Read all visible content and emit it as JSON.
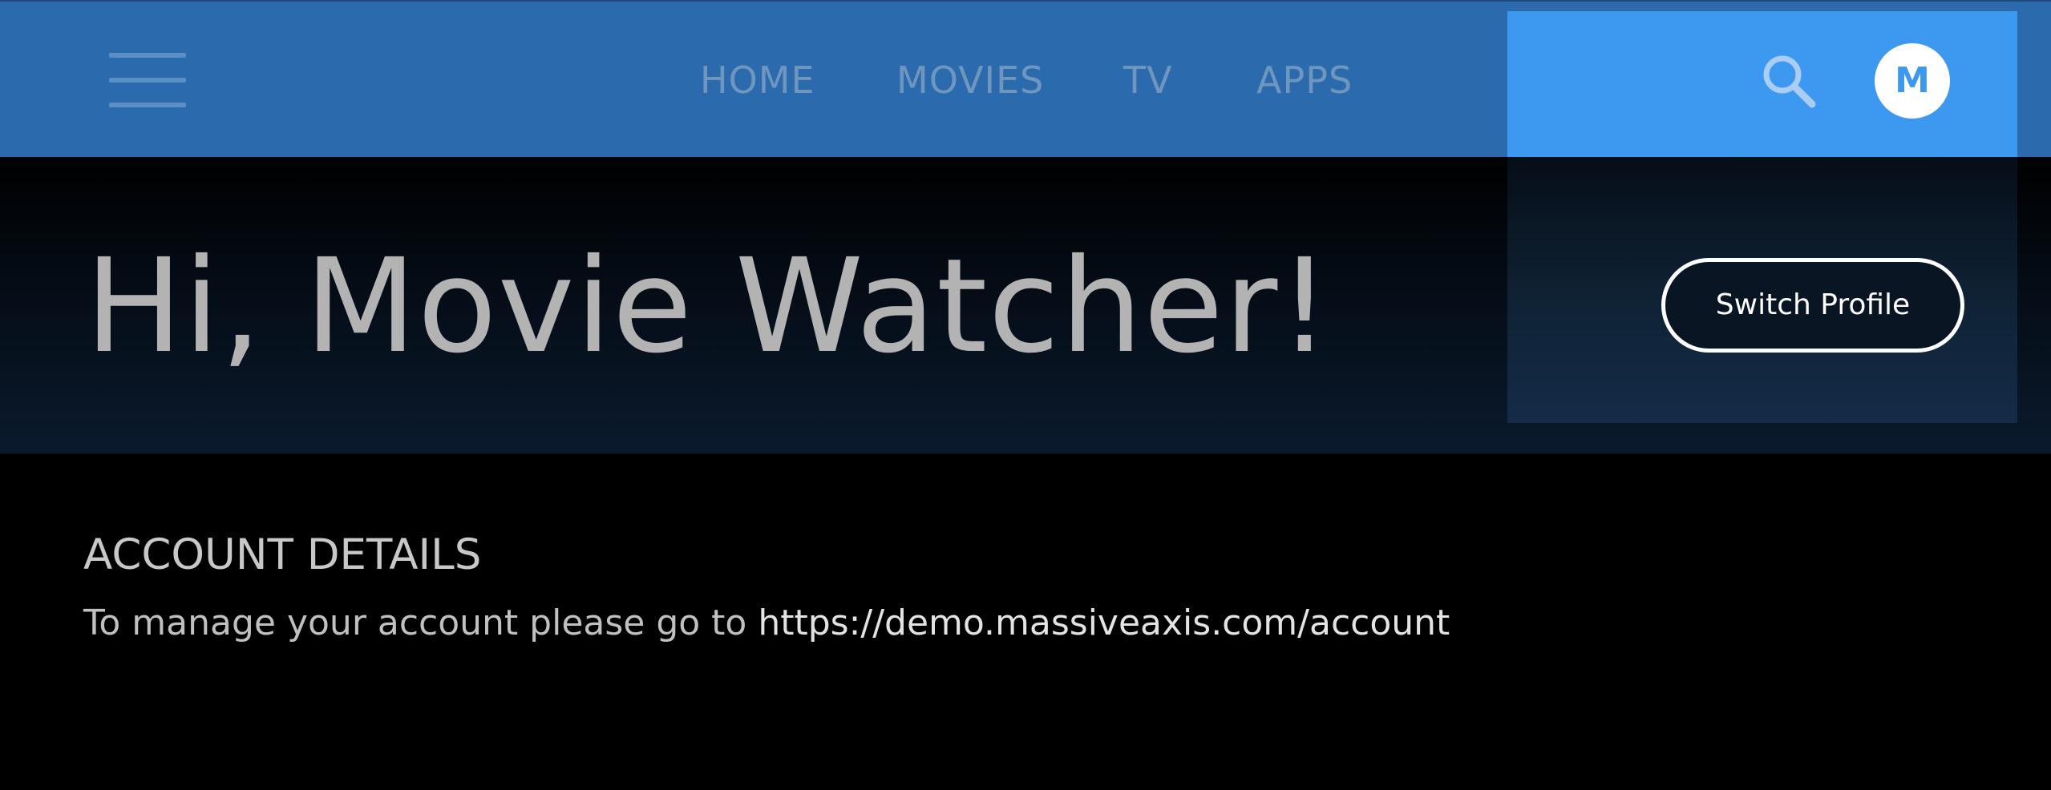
{
  "nav": {
    "items": [
      {
        "label": "HOME"
      },
      {
        "label": "MOVIES"
      },
      {
        "label": "TV"
      },
      {
        "label": "APPS"
      }
    ]
  },
  "user": {
    "avatar_initial": "M"
  },
  "hero": {
    "greeting": "Hi, Movie Watcher!",
    "switch_profile_label": "Switch Profile"
  },
  "account": {
    "heading": "ACCOUNT DETAILS",
    "instruction": "To manage your account please go to ",
    "link": "https://demo.massiveaxis.com/account"
  },
  "colors": {
    "nav_bg": "#2b6bad",
    "nav_text": "#6f96bf",
    "accent_panel": "#3d98ef",
    "background": "#000000"
  },
  "icons": {
    "menu": "hamburger-menu-icon",
    "search": "search-icon"
  }
}
